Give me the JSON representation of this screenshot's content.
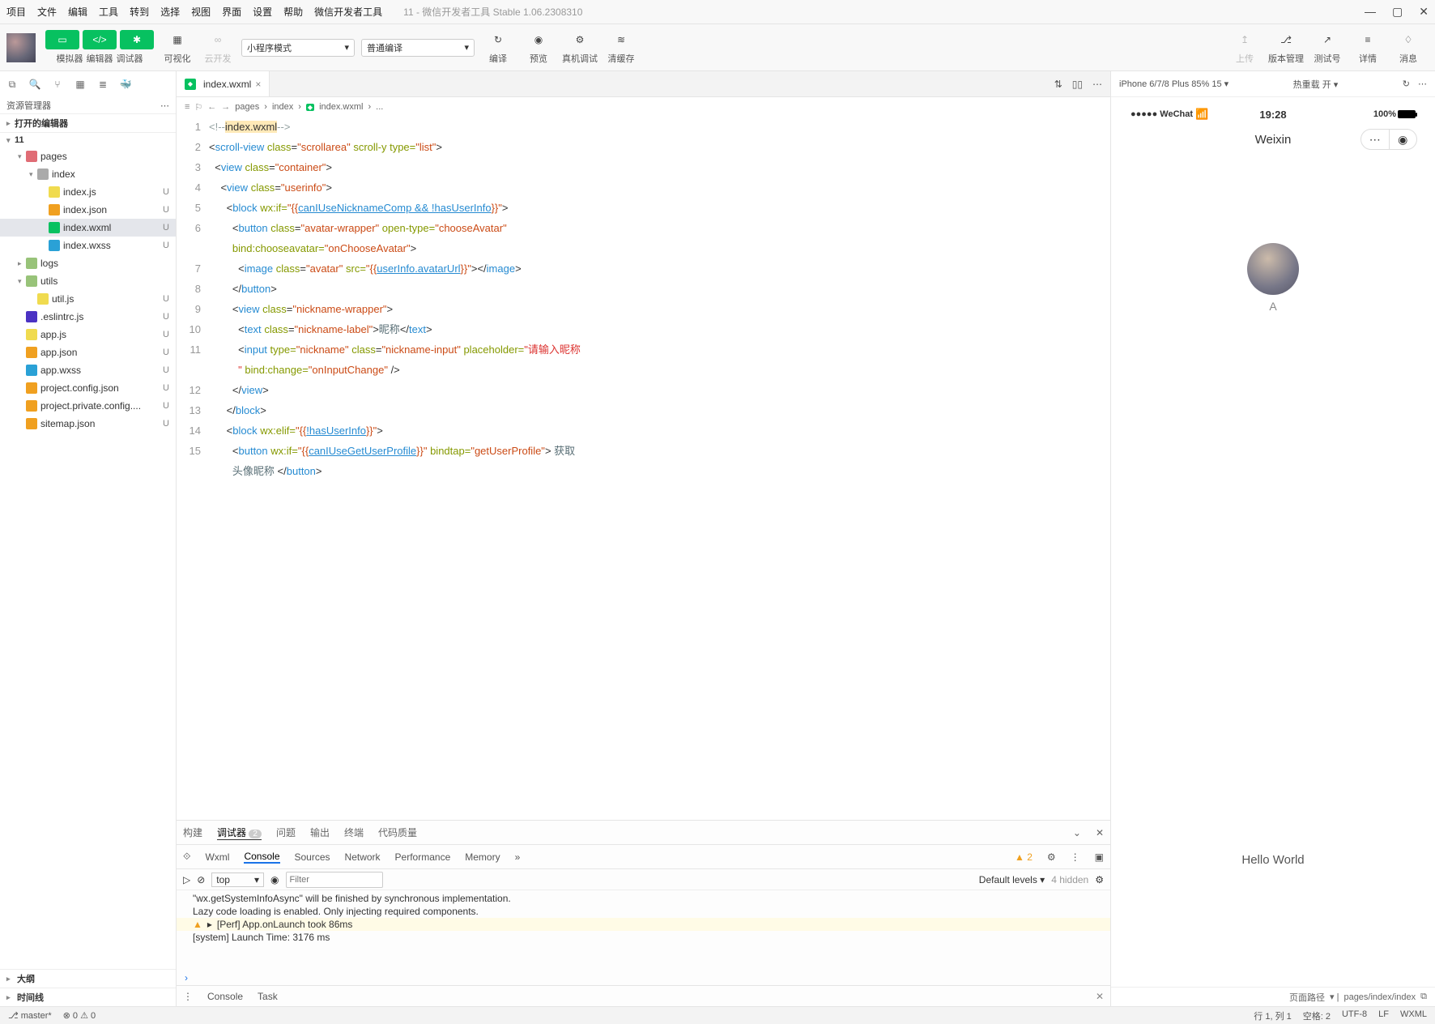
{
  "menubar": {
    "items": [
      "项目",
      "文件",
      "编辑",
      "工具",
      "转到",
      "选择",
      "视图",
      "界面",
      "设置",
      "帮助",
      "微信开发者工具"
    ],
    "title": "11 - 微信开发者工具 Stable 1.06.2308310"
  },
  "toolbar": {
    "groups": [
      {
        "buttons": [
          "phone",
          "code",
          "bug"
        ],
        "green": true,
        "labels": [
          "模拟器",
          "编辑器",
          "调试器"
        ]
      },
      {
        "icon": "layout",
        "label": "可视化"
      },
      {
        "icon": "cloud",
        "label": "云开发",
        "disabled": true
      }
    ],
    "select1": "小程序模式",
    "select2": "普通编译",
    "right": [
      {
        "icon": "refresh",
        "label": "编译"
      },
      {
        "icon": "eye",
        "label": "预览"
      },
      {
        "icon": "phone-debug",
        "label": "真机调试"
      },
      {
        "icon": "clear",
        "label": "清缓存"
      }
    ],
    "far_right": [
      {
        "icon": "upload",
        "label": "上传",
        "disabled": true
      },
      {
        "icon": "git",
        "label": "版本管理"
      },
      {
        "icon": "test",
        "label": "测试号"
      },
      {
        "icon": "menu",
        "label": "详情"
      },
      {
        "icon": "bell",
        "label": "消息"
      }
    ]
  },
  "explorer": {
    "title": "资源管理器",
    "section_open": "打开的编辑器",
    "project": "11",
    "tree": [
      {
        "depth": 1,
        "chev": "▾",
        "icon": "folder-red",
        "name": "pages",
        "badge": "●"
      },
      {
        "depth": 2,
        "chev": "▾",
        "icon": "folder-grey",
        "name": "index",
        "badge": "●"
      },
      {
        "depth": 3,
        "chev": "",
        "icon": "js",
        "name": "index.js",
        "badge": "U"
      },
      {
        "depth": 3,
        "chev": "",
        "icon": "json",
        "name": "index.json",
        "badge": "U"
      },
      {
        "depth": 3,
        "chev": "",
        "icon": "wxml",
        "name": "index.wxml",
        "badge": "U",
        "sel": true
      },
      {
        "depth": 3,
        "chev": "",
        "icon": "wxss",
        "name": "index.wxss",
        "badge": "U"
      },
      {
        "depth": 1,
        "chev": "▸",
        "icon": "folder-green",
        "name": "logs",
        "badge": "●"
      },
      {
        "depth": 1,
        "chev": "▾",
        "icon": "folder-green",
        "name": "utils",
        "badge": "●"
      },
      {
        "depth": 2,
        "chev": "",
        "icon": "js",
        "name": "util.js",
        "badge": "U"
      },
      {
        "depth": 1,
        "chev": "",
        "icon": "eslint",
        "name": ".eslintrc.js",
        "badge": "U"
      },
      {
        "depth": 1,
        "chev": "",
        "icon": "js",
        "name": "app.js",
        "badge": "U"
      },
      {
        "depth": 1,
        "chev": "",
        "icon": "json",
        "name": "app.json",
        "badge": "U"
      },
      {
        "depth": 1,
        "chev": "",
        "icon": "wxss",
        "name": "app.wxss",
        "badge": "U"
      },
      {
        "depth": 1,
        "chev": "",
        "icon": "json",
        "name": "project.config.json",
        "badge": "U"
      },
      {
        "depth": 1,
        "chev": "",
        "icon": "json",
        "name": "project.private.config....",
        "badge": "U"
      },
      {
        "depth": 1,
        "chev": "",
        "icon": "json",
        "name": "sitemap.json",
        "badge": "U"
      }
    ],
    "section_outline": "大纲",
    "section_timeline": "时间线"
  },
  "editor": {
    "tab": {
      "icon": "wxml",
      "name": "index.wxml"
    },
    "breadcrumb": [
      "pages",
      "index",
      "index.wxml",
      "..."
    ],
    "line_numbers": [
      "1",
      "2",
      "3",
      "4",
      "5",
      "6",
      "",
      "7",
      "8",
      "9",
      "10",
      "11",
      "",
      "12",
      "13",
      "14",
      "15",
      ""
    ],
    "code_tokens": {
      "l1": "<!--index.wxml-->",
      "l2": {
        "tag": "scroll-view",
        "class": "scrollarea",
        "attrs": " scroll-y type=",
        "val2": "list"
      },
      "l3": {
        "tag": "view",
        "class": "container"
      },
      "l4": {
        "tag": "view",
        "class": "userinfo"
      },
      "l5": {
        "tag": "block",
        "attr": " wx:if=",
        "expr1": "canIUseNicknameComp && !hasUserInfo"
      },
      "l6": {
        "tag": "button",
        "class": "avatar-wrapper",
        "attr2": "open-type=",
        "val2": "chooseAvatar",
        "line2_attr": "bind:chooseavatar=",
        "line2_val": "onChooseAvatar"
      },
      "l7": {
        "tag": "image",
        "class": "avatar",
        "attr2": "src=",
        "expr": "userInfo.avatarUrl"
      },
      "l8": "</button>",
      "l9": {
        "tag": "view",
        "class": "nickname-wrapper"
      },
      "l10": {
        "tag": "text",
        "class": "nickname-label",
        "txt": "昵称"
      },
      "l11": {
        "tag": "input",
        "attr1": "type=",
        "val1": "nickname",
        "class": "nickname-input",
        "attr2": "placeholder=",
        "val2": "请输入昵称",
        "line2_attr": " bind:change=",
        "line2_val": "onInputChange"
      },
      "l12": "</view>",
      "l13": "</block>",
      "l14": {
        "tag": "block",
        "attr": " wx:elif=",
        "expr1": "!hasUserInfo"
      },
      "l15": {
        "tag": "button",
        "attr1": " wx:if=",
        "expr1": "canIUseGetUserProfile",
        "attr2": "bindtap=",
        "val2": "getUserProfile",
        "txt": " 获取头像昵称 "
      }
    }
  },
  "panel": {
    "tabs": [
      "构建",
      "调试器",
      "问题",
      "输出",
      "终端",
      "代码质量"
    ],
    "active_tab": "调试器",
    "badge": "2",
    "devtools": [
      "Wxml",
      "Console",
      "Sources",
      "Network",
      "Performance",
      "Memory"
    ],
    "devtools_active": "Console",
    "warn_count": "2",
    "console_toolbar": {
      "context": "top",
      "filter_placeholder": "Filter",
      "levels": "Default levels",
      "hidden": "4 hidden"
    },
    "console_lines": [
      {
        "type": "normal",
        "text": "  \"wx.getSystemInfoAsync\" will be finished by synchronous implementation."
      },
      {
        "type": "normal",
        "text": "  Lazy code loading is enabled. Only injecting required components."
      },
      {
        "type": "warn",
        "text": "[Perf] App.onLaunch took 86ms"
      },
      {
        "type": "normal",
        "text": "  [system] Launch Time: 3176 ms"
      }
    ],
    "footer": [
      "Console",
      "Task"
    ]
  },
  "preview": {
    "device": "iPhone 6/7/8 Plus 85% 15",
    "mode": "热重载 开",
    "status": {
      "signal": "●●●●● WeChat",
      "wifi": "≋",
      "time": "19:28",
      "battery": "100%"
    },
    "nav_title": "Weixin",
    "nickname": "A",
    "body_text": "Hello World",
    "footer": {
      "label": "页面路径",
      "path": "pages/index/index"
    }
  },
  "statusbar": {
    "branch": "master*",
    "err": "0",
    "warn": "0",
    "pos": "行 1, 列 1",
    "spaces": "空格: 2",
    "enc": "UTF-8",
    "eol": "LF",
    "lang": "WXML"
  }
}
